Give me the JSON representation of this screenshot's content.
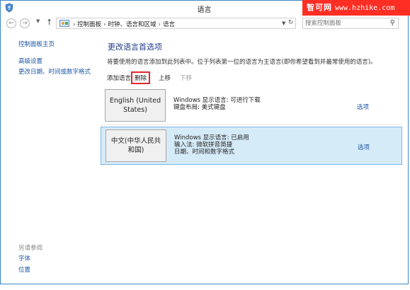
{
  "window": {
    "title": "语言"
  },
  "watermark": {
    "text_cn": "智可网",
    "text_url": "www.hzhike.com"
  },
  "titlebar": {
    "minimize": "—",
    "maximize": "□",
    "close": "✕"
  },
  "nav": {
    "back_icon": "back-arrow-icon",
    "forward_icon": "forward-arrow-icon",
    "up_icon": "up-arrow-icon",
    "breadcrumbs": [
      "控制面板",
      "时钟、语言和区域",
      "语言"
    ],
    "search_placeholder": "搜索控制面板"
  },
  "sidebar": {
    "home": "控制面板主页",
    "advanced": "高级设置",
    "change_date": "更改日期、时间或数字格式",
    "see_also_label": "另请参阅",
    "fonts": "字体",
    "location": "位置"
  },
  "main": {
    "title": "更改语言首选项",
    "description": "将要使用的语言添加到此列表中。位于列表第一位的语言为主语言(即你希望看到并最常使用的语言)。",
    "toolbar": {
      "add": "添加语言",
      "remove": "删除",
      "move_up": "上移",
      "move_down": "下移"
    },
    "languages": [
      {
        "name_line1": "English (United",
        "name_line2": "States)",
        "info_line1": "Windows 显示语言: 可进行下载",
        "info_line2": "键盘布局: 美式键盘",
        "info_line3": "",
        "options": "选项"
      },
      {
        "name_line1": "中文(中华人民共",
        "name_line2": "和国)",
        "info_line1": "Windows 显示语言: 已启用",
        "info_line2": "输入法: 微软拼音简捷",
        "info_line3": "日期、时间和数字格式",
        "options": "选项"
      }
    ]
  },
  "colors": {
    "frame": "#3f86c6",
    "link": "#1a56a6",
    "selected_bg": "#d6ebf8",
    "highlight_border": "#e0282e",
    "watermark_bg": "#ff2e24"
  }
}
